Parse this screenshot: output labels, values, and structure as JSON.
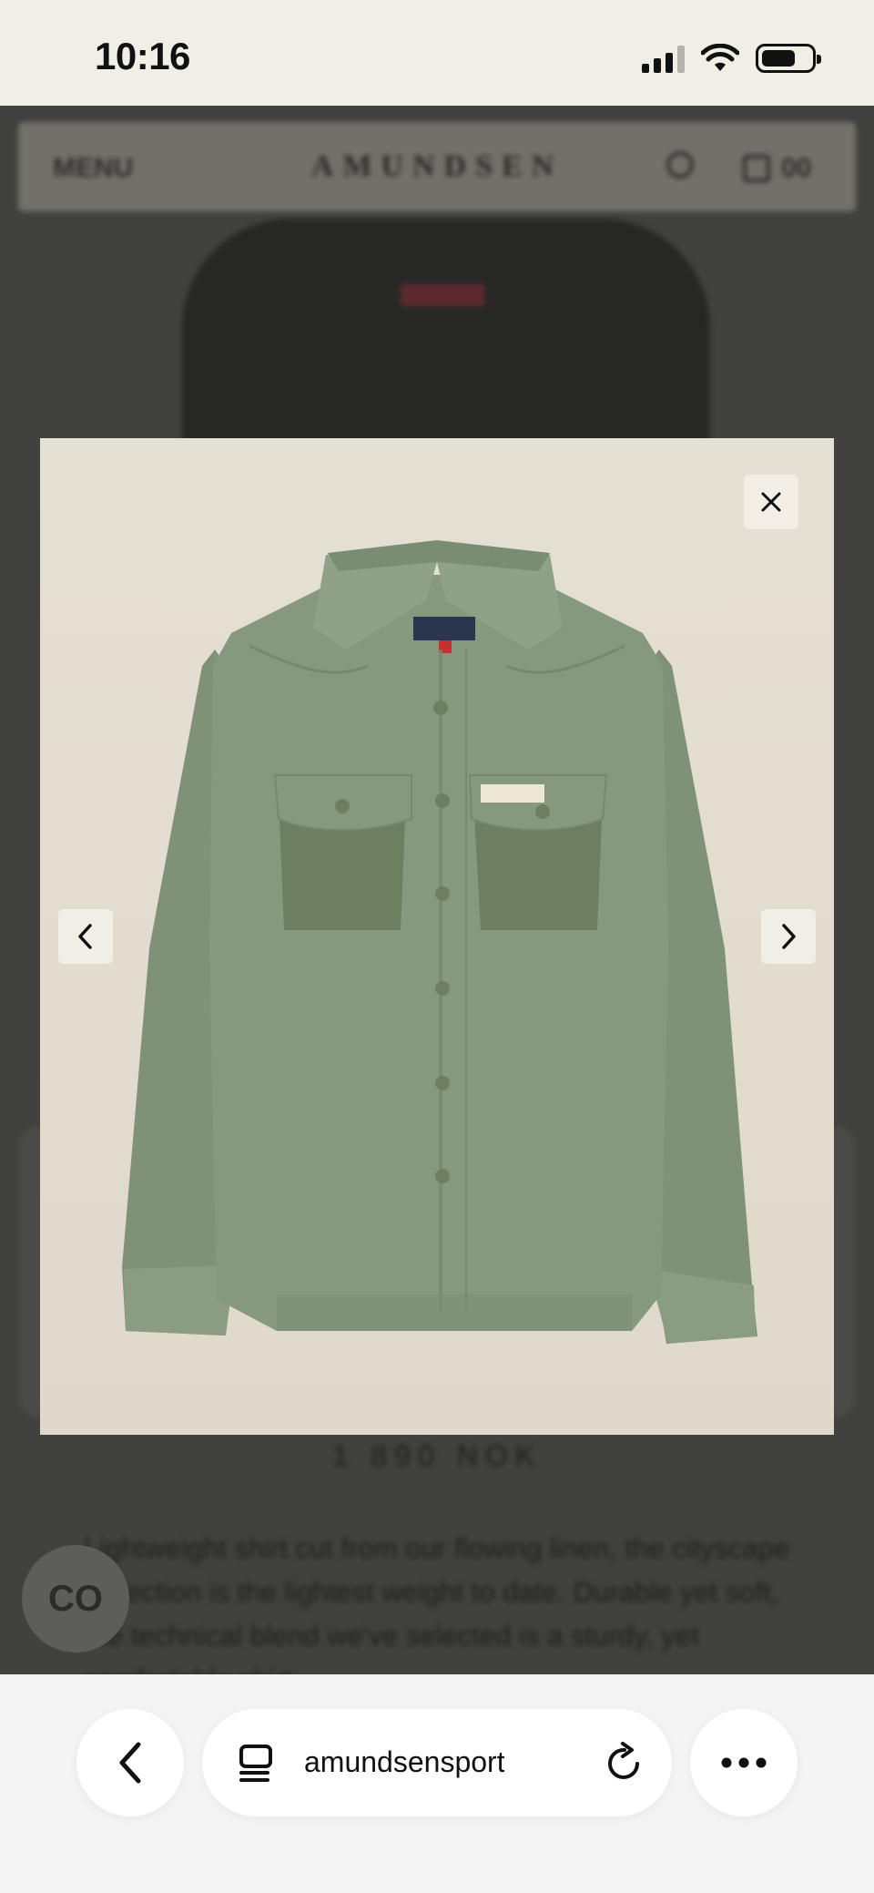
{
  "status_bar": {
    "time": "10:16"
  },
  "site_header": {
    "menu_label": "MENU",
    "logo_text": "AMUNDSEN",
    "cart_count": "00"
  },
  "background_page": {
    "price": "1 890 NOK",
    "description": "Lightweight shirt cut from our flowing linen, the cityscape collection is the lightest weight to date. Durable yet soft, the technical blend we've selected is a sturdy, yet comfortable shirt."
  },
  "badge": {
    "label": "CO"
  },
  "lightbox": {
    "close_icon": "close-icon",
    "prev_icon": "chevron-left-icon",
    "next_icon": "chevron-right-icon",
    "image_alt": "Green long-sleeve shirt with two chest pockets",
    "colors": {
      "shirt": "#86997e",
      "shirt_shadow": "#76896e",
      "pocket_panel": "#6d7f60",
      "label_navy": "#2a3550",
      "label_red": "#c53030"
    }
  },
  "browser": {
    "url": "amundsensports.com",
    "back_icon": "chevron-left-icon",
    "tabs_icon": "tabs-icon",
    "reload_icon": "reload-icon",
    "more_icon": "ellipsis-icon"
  }
}
